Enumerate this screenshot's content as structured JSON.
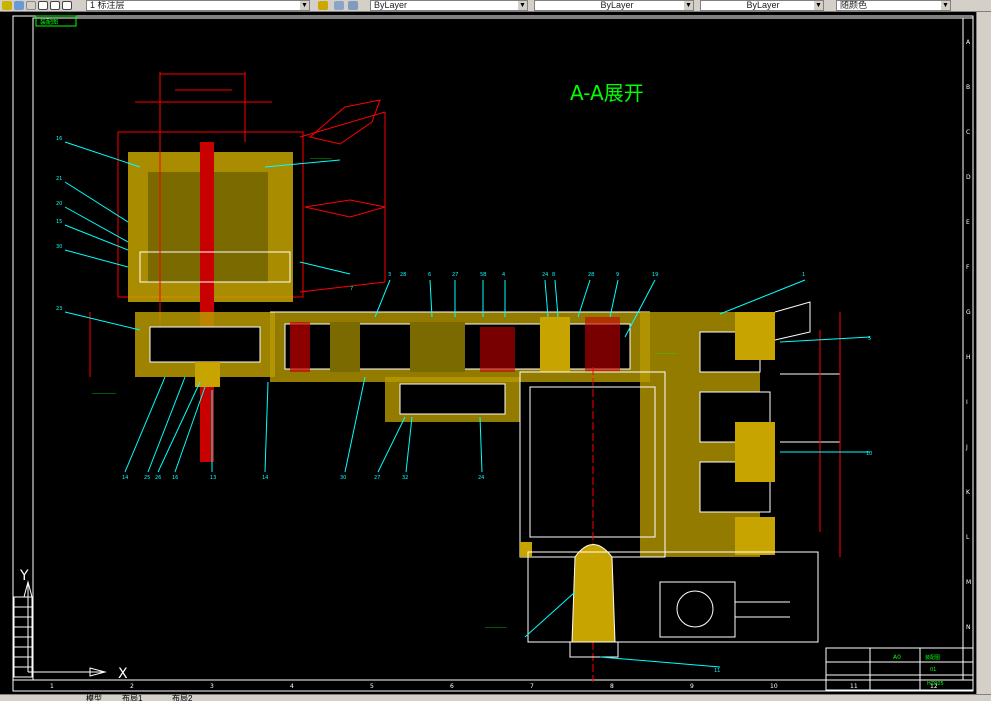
{
  "toolbar": {
    "layer_label": "1 标注层",
    "color_value": "ByLayer",
    "linetype_value": "ByLayer",
    "lineweight_value": "ByLayer",
    "plotstyle_value": "随颜色"
  },
  "drawing": {
    "view_title": "A-A展开",
    "top_left_box_text": "装配图",
    "axis_y": "Y",
    "axis_x": "X",
    "border_numbers_bottom": [
      "1",
      "2",
      "3",
      "4",
      "5",
      "6",
      "7",
      "8",
      "9",
      "10",
      "11",
      "12"
    ],
    "border_letters_right": [
      "A",
      "B",
      "C",
      "D",
      "E",
      "F",
      "G",
      "H",
      "I",
      "J",
      "K",
      "L",
      "M",
      "N"
    ],
    "part_callouts_left": [
      "16",
      "21",
      "20",
      "15",
      "30",
      "23"
    ],
    "part_callouts_top": [
      "3",
      "28",
      "6",
      "27",
      "5B",
      "4",
      "24",
      "8",
      "28",
      "9",
      "19",
      "1"
    ],
    "part_callouts_bottom": [
      "14",
      "25",
      "26",
      "16",
      "13",
      "14",
      "30",
      "27",
      "32",
      "24"
    ],
    "part_callouts_right": [
      "5",
      "7",
      "10",
      "11"
    ],
    "title_block": {
      "label_a": "A0",
      "label_b": "装配图",
      "label_c": "01",
      "label_d": "HZ005"
    }
  },
  "bottom_tabs": {
    "model_tab": "模型",
    "layout1_tab": "布局1",
    "layout2_tab": "布局2"
  },
  "colors": {
    "canvas_bg": "#000000",
    "frame_line": "#ffffff",
    "outline_green": "#00ff00",
    "yellow": "#ffff00",
    "cyan": "#00ffff",
    "red": "#ff0000",
    "magenta": "#ff00ff"
  }
}
